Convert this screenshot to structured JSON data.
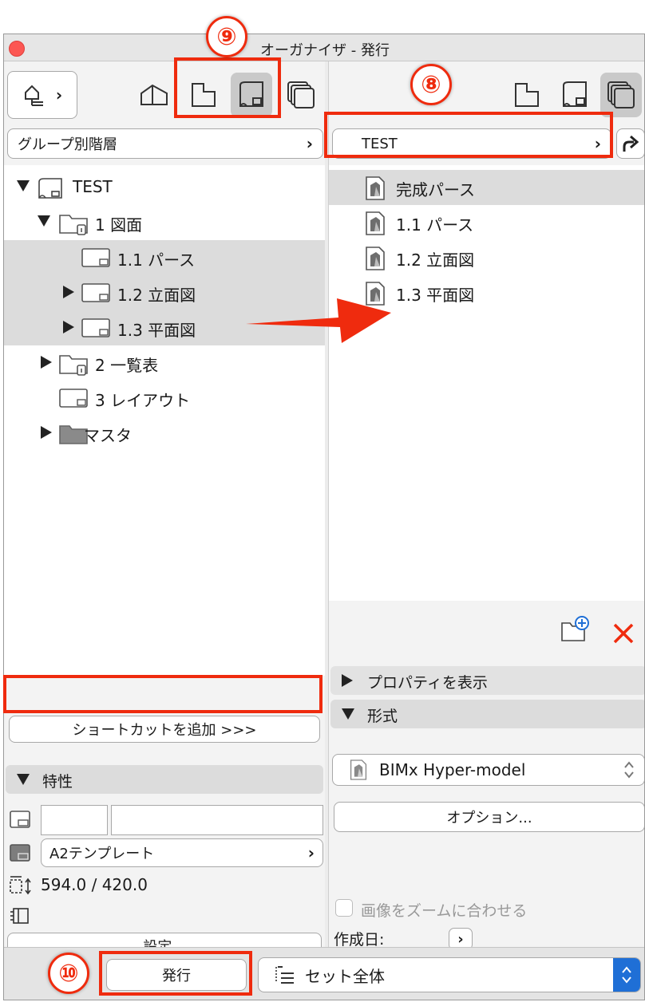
{
  "window": {
    "title": "オーガナイザ - 発行"
  },
  "left": {
    "view_mode_label": "グループ別階層",
    "tree": [
      {
        "label": "TEST",
        "expander": "down",
        "icon": "project-book-icon",
        "depth": 0
      },
      {
        "label": "1 図面",
        "expander": "down",
        "icon": "folder-icon",
        "depth": 1
      },
      {
        "label": "1.1 パース",
        "expander": "none",
        "icon": "layout-icon",
        "depth": 2,
        "highlighted": true
      },
      {
        "label": "1.2 立面図",
        "expander": "right",
        "icon": "layout-icon",
        "depth": 2,
        "highlighted": true
      },
      {
        "label": "1.3 平面図",
        "expander": "right",
        "icon": "layout-icon",
        "depth": 2,
        "highlighted": true
      },
      {
        "label": "2 一覧表",
        "expander": "right",
        "icon": "folder-icon",
        "depth": 1
      },
      {
        "label": "3 レイアウト",
        "expander": "none",
        "icon": "layout-icon",
        "depth": 1
      },
      {
        "label": "マスタ",
        "expander": "right",
        "icon": "master-folder-icon",
        "depth": 1
      }
    ],
    "add_shortcut_label": "ショートカットを追加 >>>",
    "properties_header": "特性",
    "master_value": "A2テンプレート",
    "size_value": "594.0 / 420.0",
    "settings_label": "設定..."
  },
  "right": {
    "publisher_set": "TEST",
    "items": [
      {
        "label": "完成パース",
        "highlighted": true
      },
      {
        "label": "1.1 パース"
      },
      {
        "label": "1.2 立面図"
      },
      {
        "label": "1.3 平面図"
      }
    ],
    "show_properties_label": "プロパティを表示",
    "format_header": "形式",
    "format_value": "BIMx Hyper-model",
    "options_label": "オプション...",
    "zoom_checkbox_label": "画像をズームに合わせる",
    "created_label": "作成日:"
  },
  "bottom": {
    "publish_label": "発行",
    "scope_value": "セット全体"
  },
  "annotations": {
    "n8": "⑧",
    "n9": "⑨",
    "n10": "⑩"
  },
  "colors": {
    "highlight": "#ef2b0e",
    "selection": "#dcdcdc",
    "accent_blue": "#1f6fd6"
  }
}
